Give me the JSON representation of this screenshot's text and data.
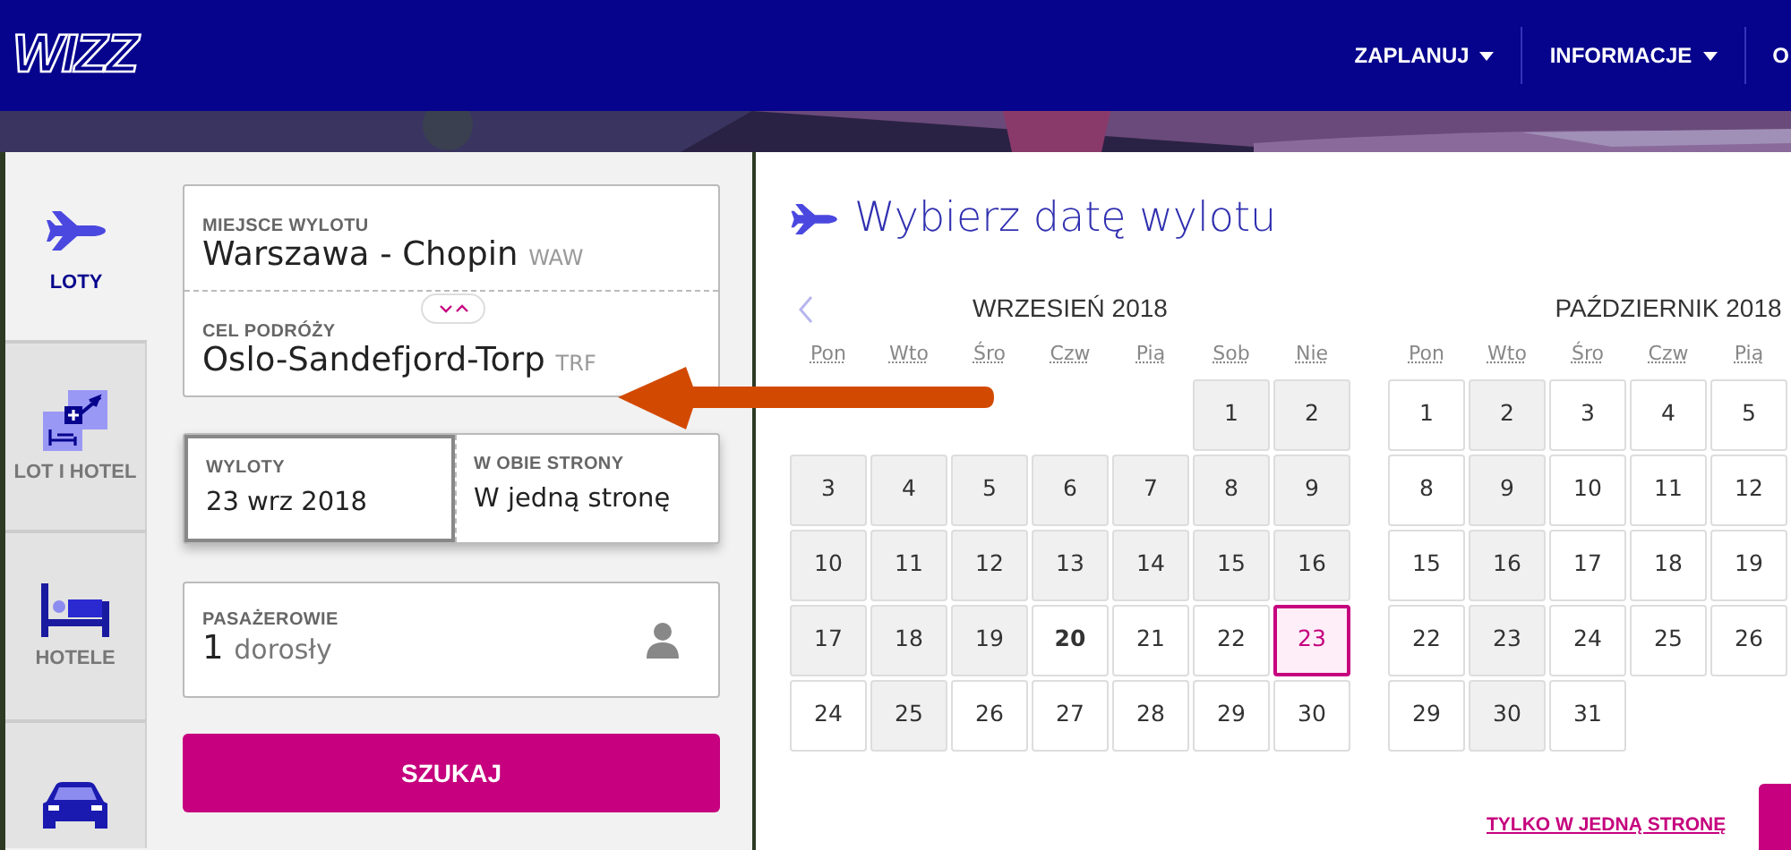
{
  "header": {
    "logo": "WIZZ",
    "nav": [
      {
        "label": "ZAPLANUJ",
        "dropdown": true
      },
      {
        "label": "INFORMACJE",
        "dropdown": true
      },
      {
        "label": "O",
        "dropdown": false
      }
    ]
  },
  "sidebar": {
    "tabs": [
      {
        "label": "LOTY",
        "kind": "plane",
        "selected": true
      },
      {
        "label": "LOT I HOTEL",
        "kind": "combo",
        "selected": false
      },
      {
        "label": "HOTELE",
        "kind": "bed",
        "selected": false
      },
      {
        "kind": "car",
        "selected": false
      }
    ]
  },
  "form": {
    "origin": {
      "label": "MIEJSCE WYLOTU",
      "value": "Warszawa - Chopin",
      "code": "WAW"
    },
    "destination": {
      "label": "CEL PODRÓŻY",
      "value": "Oslo-Sandefjord-Torp",
      "code": "TRF"
    },
    "departure": {
      "label": "WYLOTY",
      "value": "23 wrz 2018",
      "selected": true
    },
    "trip_type": {
      "label": "W OBIE STRONY",
      "value": "W jedną stronę",
      "selected": false
    },
    "passengers": {
      "label": "PASAŻEROWIE",
      "count": "1",
      "unit": "dorosły"
    },
    "search_button": "SZUKAJ"
  },
  "calendar": {
    "title": "Wybierz datę wylotu",
    "months": [
      {
        "title": "WRZESIEŃ 2018",
        "weekdays": [
          "Pon",
          "Wto",
          "Śro",
          "Czw",
          "Pią",
          "Sob",
          "Nie"
        ],
        "days": [
          {
            "kind": "empty"
          },
          {
            "kind": "empty"
          },
          {
            "kind": "empty"
          },
          {
            "kind": "empty"
          },
          {
            "kind": "empty"
          },
          {
            "kind": "day",
            "day": "1",
            "available": false,
            "today": false,
            "selected": false
          },
          {
            "kind": "day",
            "day": "2",
            "available": false,
            "today": false,
            "selected": false
          },
          {
            "kind": "day",
            "day": "3",
            "available": false,
            "today": false,
            "selected": false
          },
          {
            "kind": "day",
            "day": "4",
            "available": false,
            "today": false,
            "selected": false
          },
          {
            "kind": "day",
            "day": "5",
            "available": false,
            "today": false,
            "selected": false
          },
          {
            "kind": "day",
            "day": "6",
            "available": false,
            "today": false,
            "selected": false
          },
          {
            "kind": "day",
            "day": "7",
            "available": false,
            "today": false,
            "selected": false
          },
          {
            "kind": "day",
            "day": "8",
            "available": false,
            "today": false,
            "selected": false
          },
          {
            "kind": "day",
            "day": "9",
            "available": false,
            "today": false,
            "selected": false
          },
          {
            "kind": "day",
            "day": "10",
            "available": false,
            "today": false,
            "selected": false
          },
          {
            "kind": "day",
            "day": "11",
            "available": false,
            "today": false,
            "selected": false
          },
          {
            "kind": "day",
            "day": "12",
            "available": false,
            "today": false,
            "selected": false
          },
          {
            "kind": "day",
            "day": "13",
            "available": false,
            "today": false,
            "selected": false
          },
          {
            "kind": "day",
            "day": "14",
            "available": false,
            "today": false,
            "selected": false
          },
          {
            "kind": "day",
            "day": "15",
            "available": false,
            "today": false,
            "selected": false
          },
          {
            "kind": "day",
            "day": "16",
            "available": false,
            "today": false,
            "selected": false
          },
          {
            "kind": "day",
            "day": "17",
            "available": false,
            "today": false,
            "selected": false
          },
          {
            "kind": "day",
            "day": "18",
            "available": false,
            "today": false,
            "selected": false
          },
          {
            "kind": "day",
            "day": "19",
            "available": false,
            "today": false,
            "selected": false
          },
          {
            "kind": "day",
            "day": "20",
            "available": true,
            "today": true,
            "selected": false
          },
          {
            "kind": "day",
            "day": "21",
            "available": true,
            "today": false,
            "selected": false
          },
          {
            "kind": "day",
            "day": "22",
            "available": true,
            "today": false,
            "selected": false
          },
          {
            "kind": "day",
            "day": "23",
            "available": true,
            "today": false,
            "selected": true
          },
          {
            "kind": "day",
            "day": "24",
            "available": true,
            "today": false,
            "selected": false
          },
          {
            "kind": "day",
            "day": "25",
            "available": false,
            "today": false,
            "selected": false
          },
          {
            "kind": "day",
            "day": "26",
            "available": true,
            "today": false,
            "selected": false
          },
          {
            "kind": "day",
            "day": "27",
            "available": true,
            "today": false,
            "selected": false
          },
          {
            "kind": "day",
            "day": "28",
            "available": true,
            "today": false,
            "selected": false
          },
          {
            "kind": "day",
            "day": "29",
            "available": true,
            "today": false,
            "selected": false
          },
          {
            "kind": "day",
            "day": "30",
            "available": true,
            "today": false,
            "selected": false
          }
        ]
      },
      {
        "title": "PAŹDZIERNIK 2018",
        "weekdays": [
          "Pon",
          "Wto",
          "Śro",
          "Czw",
          "Pią"
        ],
        "days": [
          {
            "kind": "day",
            "day": "1",
            "available": true,
            "today": false,
            "selected": false
          },
          {
            "kind": "day",
            "day": "2",
            "available": false,
            "today": false,
            "selected": false
          },
          {
            "kind": "day",
            "day": "3",
            "available": true,
            "today": false,
            "selected": false
          },
          {
            "kind": "day",
            "day": "4",
            "available": true,
            "today": false,
            "selected": false
          },
          {
            "kind": "day",
            "day": "5",
            "available": true,
            "today": false,
            "selected": false
          },
          {
            "kind": "day",
            "day": "8",
            "available": true,
            "today": false,
            "selected": false
          },
          {
            "kind": "day",
            "day": "9",
            "available": false,
            "today": false,
            "selected": false
          },
          {
            "kind": "day",
            "day": "10",
            "available": true,
            "today": false,
            "selected": false
          },
          {
            "kind": "day",
            "day": "11",
            "available": true,
            "today": false,
            "selected": false
          },
          {
            "kind": "day",
            "day": "12",
            "available": true,
            "today": false,
            "selected": false
          },
          {
            "kind": "day",
            "day": "15",
            "available": true,
            "today": false,
            "selected": false
          },
          {
            "kind": "day",
            "day": "16",
            "available": false,
            "today": false,
            "selected": false
          },
          {
            "kind": "day",
            "day": "17",
            "available": true,
            "today": false,
            "selected": false
          },
          {
            "kind": "day",
            "day": "18",
            "available": true,
            "today": false,
            "selected": false
          },
          {
            "kind": "day",
            "day": "19",
            "available": true,
            "today": false,
            "selected": false
          },
          {
            "kind": "day",
            "day": "22",
            "available": true,
            "today": false,
            "selected": false
          },
          {
            "kind": "day",
            "day": "23",
            "available": false,
            "today": false,
            "selected": false
          },
          {
            "kind": "day",
            "day": "24",
            "available": true,
            "today": false,
            "selected": false
          },
          {
            "kind": "day",
            "day": "25",
            "available": true,
            "today": false,
            "selected": false
          },
          {
            "kind": "day",
            "day": "26",
            "available": true,
            "today": false,
            "selected": false
          },
          {
            "kind": "day",
            "day": "29",
            "available": true,
            "today": false,
            "selected": false
          },
          {
            "kind": "day",
            "day": "30",
            "available": false,
            "today": false,
            "selected": false
          },
          {
            "kind": "day",
            "day": "31",
            "available": true,
            "today": false,
            "selected": false
          }
        ]
      }
    ],
    "one_way_link": "TYLKO W JEDNĄ STRONĘ"
  },
  "annotation": {
    "kind": "arrow"
  }
}
